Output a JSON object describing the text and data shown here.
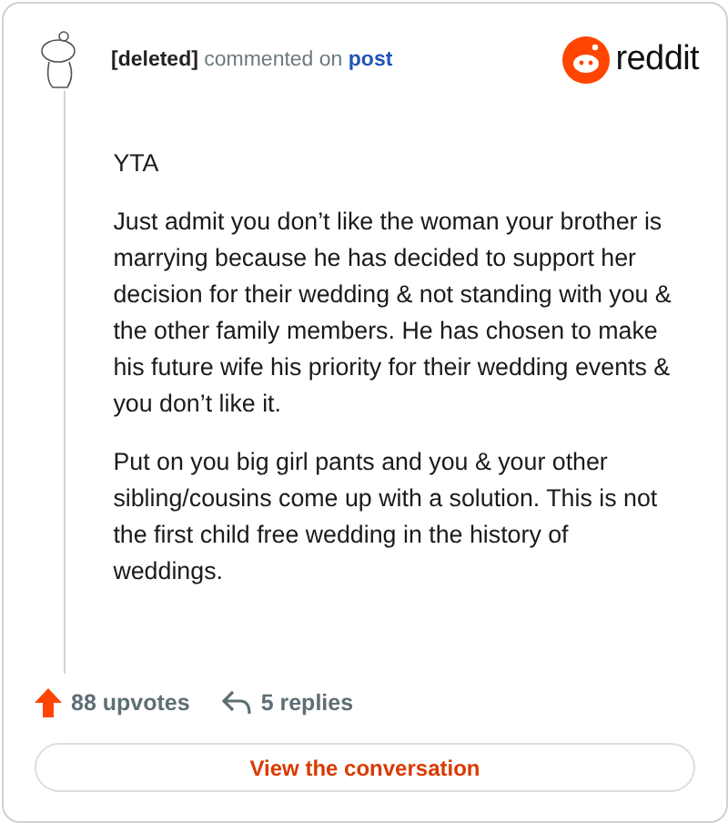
{
  "header": {
    "author": "[deleted]",
    "action": "commented on",
    "link": "post",
    "brand": "reddit"
  },
  "paragraphs": [
    "YTA",
    "Just admit you don’t like the woman your brother is marrying because he has decided to support her decision for their wedding & not standing with you & the other family members. He has chosen to make his future wife his priority for their wedding events & you don’t like it.",
    "Put on you big girl pants and you & your other sibling/cousins come up with a solution. This is not the first child free wedding in the history of weddings."
  ],
  "footer": {
    "upvotes": "88 upvotes",
    "replies": "5 replies"
  },
  "button": "View the conversation"
}
